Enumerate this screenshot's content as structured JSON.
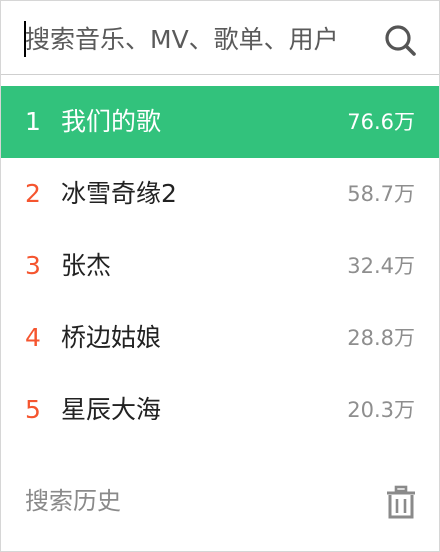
{
  "search": {
    "placeholder": "搜索音乐、MV、歌单、用户",
    "value": "",
    "icon": "search-icon"
  },
  "hot_list": [
    {
      "rank": "1",
      "title": "我们的歌",
      "count": "76.6万",
      "active": true
    },
    {
      "rank": "2",
      "title": "冰雪奇缘2",
      "count": "58.7万",
      "active": false
    },
    {
      "rank": "3",
      "title": "张杰",
      "count": "32.4万",
      "active": false
    },
    {
      "rank": "4",
      "title": "桥边姑娘",
      "count": "28.8万",
      "active": false
    },
    {
      "rank": "5",
      "title": "星辰大海",
      "count": "20.3万",
      "active": false
    }
  ],
  "history": {
    "label": "搜索历史",
    "clear_icon": "trash-icon"
  },
  "colors": {
    "accent": "#32c27c",
    "rank": "#f5552f",
    "count": "#8e8e8e"
  }
}
